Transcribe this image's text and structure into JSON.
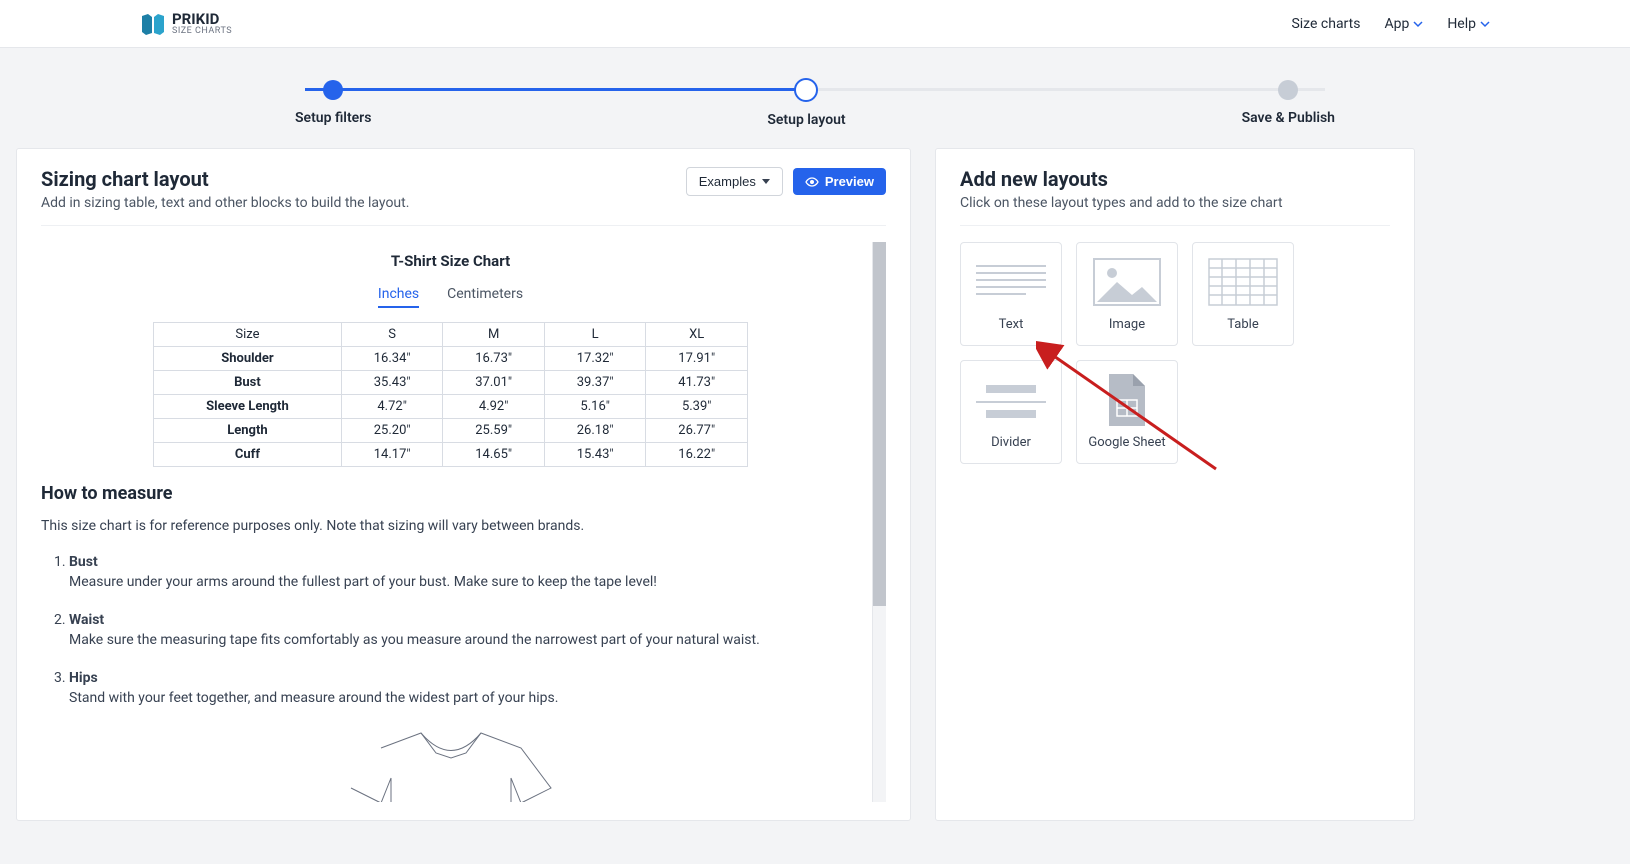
{
  "header": {
    "logo_name": "PRIKID",
    "logo_sub": "SIZE CHARTS",
    "nav": {
      "size_charts": "Size charts",
      "app": "App",
      "help": "Help"
    }
  },
  "stepper": {
    "step1": "Setup filters",
    "step2": "Setup layout",
    "step3": "Save & Publish"
  },
  "left_panel": {
    "title": "Sizing chart layout",
    "subtitle": "Add in sizing table, text and other blocks to build the layout.",
    "examples_btn": "Examples",
    "preview_btn": "Preview",
    "chart": {
      "title": "T-Shirt Size Chart",
      "units": {
        "inches": "Inches",
        "centimeters": "Centimeters"
      },
      "headers": [
        "Size",
        "S",
        "M",
        "L",
        "XL"
      ],
      "rows": [
        {
          "label": "Shoulder",
          "cells": [
            "16.34″",
            "16.73″",
            "17.32″",
            "17.91″"
          ]
        },
        {
          "label": "Bust",
          "cells": [
            "35.43″",
            "37.01″",
            "39.37″",
            "41.73″"
          ]
        },
        {
          "label": "Sleeve Length",
          "cells": [
            "4.72″",
            "4.92″",
            "5.16″",
            "5.39″"
          ]
        },
        {
          "label": "Length",
          "cells": [
            "25.20″",
            "25.59″",
            "26.18″",
            "26.77″"
          ]
        },
        {
          "label": "Cuff",
          "cells": [
            "14.17″",
            "14.65″",
            "15.43″",
            "16.22″"
          ]
        }
      ]
    },
    "how": {
      "title": "How to measure",
      "desc": "This size chart is for reference purposes only. Note that sizing will vary between brands.",
      "items": [
        {
          "title": "Bust",
          "text": "Measure under your arms around the fullest part of your bust. Make sure to keep the tape level!"
        },
        {
          "title": "Waist",
          "text": "Make sure the measuring tape fits comfortably as you measure around the narrowest part of your natural waist."
        },
        {
          "title": "Hips",
          "text": "Stand with your feet together, and measure around the widest part of your hips."
        }
      ]
    }
  },
  "right_panel": {
    "title": "Add new layouts",
    "subtitle": "Click on these layout types and add to the size chart",
    "cards": {
      "text": "Text",
      "image": "Image",
      "table": "Table",
      "divider": "Divider",
      "google_sheet": "Google Sheet"
    }
  }
}
